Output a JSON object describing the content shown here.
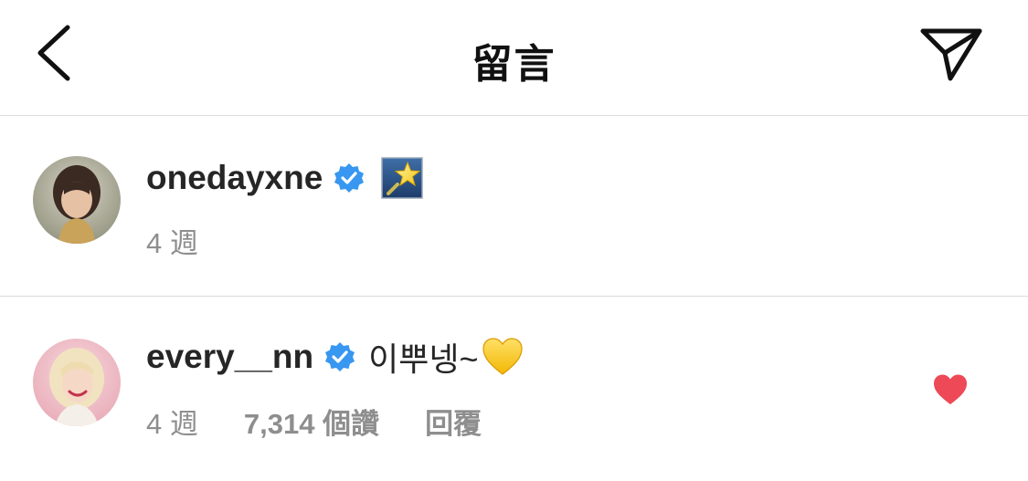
{
  "header": {
    "title": "留言",
    "back_icon": "chevron-left-icon",
    "send_icon": "paper-plane-icon"
  },
  "comments": [
    {
      "username": "onedayxne",
      "verified": true,
      "text": "",
      "emoji": "star-emoji",
      "age": "4 週"
    },
    {
      "username": "every__nn",
      "verified": true,
      "text": "이뿌넹~",
      "emoji": "yellow-heart-emoji",
      "age": "4 週",
      "likes": "7,314 個讚",
      "reply_label": "回覆",
      "liked": true
    }
  ],
  "colors": {
    "text": "#262626",
    "secondary": "#8e8e8e",
    "divider": "#dbdbdb",
    "verified": "#3897f0",
    "liked_heart": "#ed4956"
  }
}
